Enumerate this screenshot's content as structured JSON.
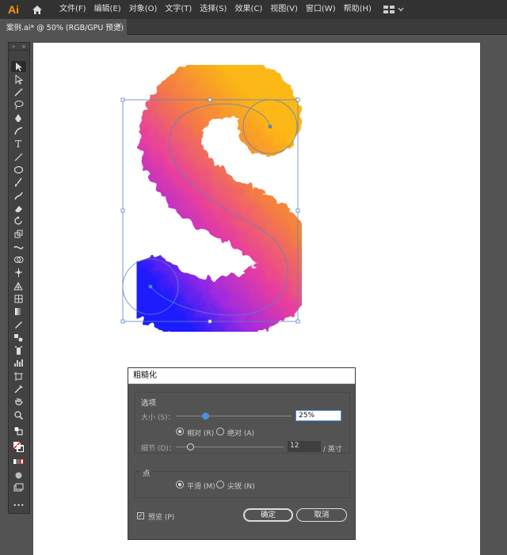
{
  "app": {
    "logo": "Ai",
    "menu": [
      "文件(F)",
      "编辑(E)",
      "对象(O)",
      "文字(T)",
      "选择(S)",
      "效果(C)",
      "视图(V)",
      "窗口(W)",
      "帮助(H)"
    ]
  },
  "document_tab": {
    "title": "案例.ai* @ 50% (RGB/GPU 预览)",
    "close": "×"
  },
  "toolbar": {
    "collapse": "»",
    "more": "•••",
    "active_tool": "selection-tool"
  },
  "artwork": {
    "letter": "S",
    "gradient_colors": [
      "#fcb813",
      "#f47b45",
      "#e83e9e",
      "#7b21e8",
      "#1a1aff"
    ],
    "selection_color": "#5b83c5"
  },
  "dialog": {
    "title": "粗糙化",
    "options_group": "选项",
    "size_label": "大小 (S)：",
    "size_value": "25%",
    "size_fraction": 0.25,
    "relative_label": "相对 (R)",
    "absolute_label": "绝对 (A)",
    "detail_label": "细节 (D)：",
    "detail_value": "12",
    "detail_unit": "/ 英寸",
    "points_group": "点",
    "smooth_label": "平滑 (M)",
    "corner_label": "尖锐 (N)",
    "preview_label": "预览 (P)",
    "preview_checked": true,
    "ok_label": "确定",
    "cancel_label": "取消",
    "accent_color": "#4a90e2"
  }
}
